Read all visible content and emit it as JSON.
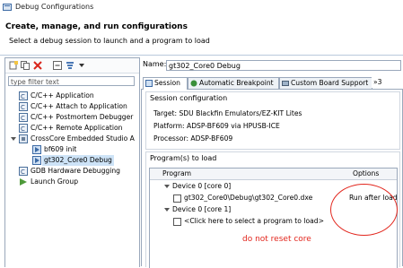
{
  "window": {
    "title": "Debug Configurations"
  },
  "header": {
    "title": "Create, manage, and run configurations",
    "subtitle": "Select a debug session to launch and a program to load"
  },
  "sidebar": {
    "filter_placeholder": "type filter text",
    "items": [
      {
        "label": "C/C++ Application",
        "icon": "c-app-icon"
      },
      {
        "label": "C/C++ Attach to Application",
        "icon": "c-attach-icon"
      },
      {
        "label": "C/C++ Postmortem Debugger",
        "icon": "c-postmortem-icon"
      },
      {
        "label": "C/C++ Remote Application",
        "icon": "c-remote-icon"
      },
      {
        "label": "CrossCore Embedded Studio A",
        "icon": "crosscore-icon"
      },
      {
        "label": "bf609 init",
        "icon": "config-icon"
      },
      {
        "label": "gt302_Core0 Debug",
        "icon": "config-icon"
      },
      {
        "label": "GDB Hardware Debugging",
        "icon": "gdb-icon"
      },
      {
        "label": "Launch Group",
        "icon": "launch-group-icon"
      }
    ]
  },
  "main": {
    "name_label": "Name:",
    "name_value": "gt302_Core0 Debug",
    "tabs": [
      {
        "label": "Session",
        "icon": "session-icon"
      },
      {
        "label": "Automatic Breakpoint",
        "icon": "breakpoint-icon"
      },
      {
        "label": "Custom Board Support",
        "icon": "board-icon"
      },
      {
        "label": "»3"
      }
    ],
    "session": {
      "title": "Session configuration",
      "target": "Target: SDU Blackfin Emulators/EZ-KIT Lites",
      "platform": "Platform: ADSP-BF609 via HPUSB-ICE",
      "processor": "Processor: ADSP-BF609"
    },
    "programs": {
      "title": "Program(s) to load",
      "col_program": "Program",
      "col_options": "Options",
      "rows": [
        {
          "label": "Device 0 [core 0]"
        },
        {
          "label": "gt302_Core0\\Debug\\gt302_Core0.dxe",
          "option": "Run after load"
        },
        {
          "label": "Device 0 [core 1]"
        },
        {
          "label": "<Click here to select a program to load>"
        }
      ]
    }
  },
  "annotation": {
    "text": "do not reset core",
    "color": "#e2261d"
  }
}
